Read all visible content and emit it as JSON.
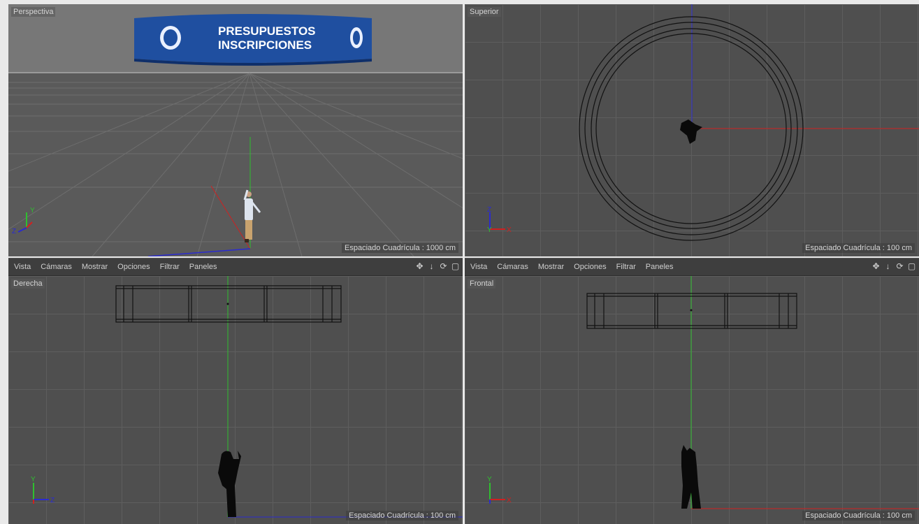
{
  "viewports": {
    "perspective": {
      "label": "Perspectiva",
      "spacing": "Espaciado Cuadrícula : 1000 cm"
    },
    "top": {
      "label": "Superior",
      "spacing": "Espaciado Cuadrícula : 100 cm"
    },
    "right": {
      "label": "Derecha",
      "spacing": "Espaciado Cuadrícula : 100 cm"
    },
    "front": {
      "label": "Frontal",
      "spacing": "Espaciado Cuadrícula : 100 cm"
    }
  },
  "menu": {
    "vista": "Vista",
    "camaras": "Cámaras",
    "mostrar": "Mostrar",
    "opciones": "Opciones",
    "filtrar": "Filtrar",
    "paneles": "Paneles"
  },
  "banner": {
    "line1": "PRESUPUESTOS",
    "line2": "INSCRIPCIONES"
  },
  "axes": {
    "x": "X",
    "y": "Y",
    "z": "Z"
  },
  "colors": {
    "x_axis": "#d02020",
    "y_axis": "#2fbf2f",
    "z_axis": "#2b2bd0",
    "viewport_bg": "#4f4f4f",
    "banner_blue": "#1f4fa0"
  },
  "icons": [
    "move-icon",
    "arrow-down-icon",
    "rotate-icon",
    "maximize-icon"
  ]
}
